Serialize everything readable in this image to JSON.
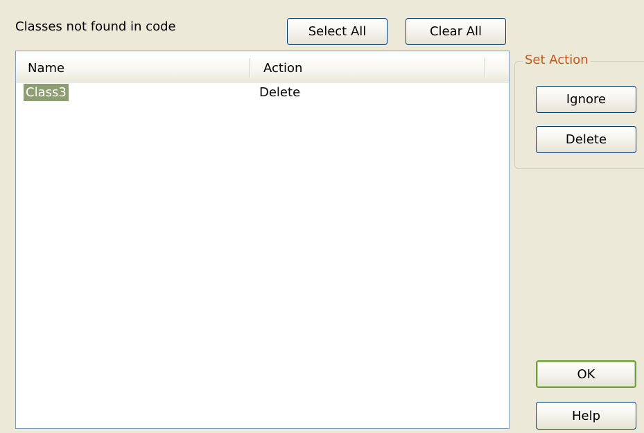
{
  "header": {
    "label": "Classes not found in code",
    "select_all_label": "Select All",
    "clear_all_label": "Clear All"
  },
  "list": {
    "columns": [
      "Name",
      "Action"
    ],
    "rows": [
      {
        "name": "Class3",
        "action": "Delete",
        "selected": true
      }
    ]
  },
  "set_action": {
    "legend": "Set Action",
    "ignore_label": "Ignore",
    "delete_label": "Delete"
  },
  "footer": {
    "ok_label": "OK",
    "help_label": "Help"
  }
}
